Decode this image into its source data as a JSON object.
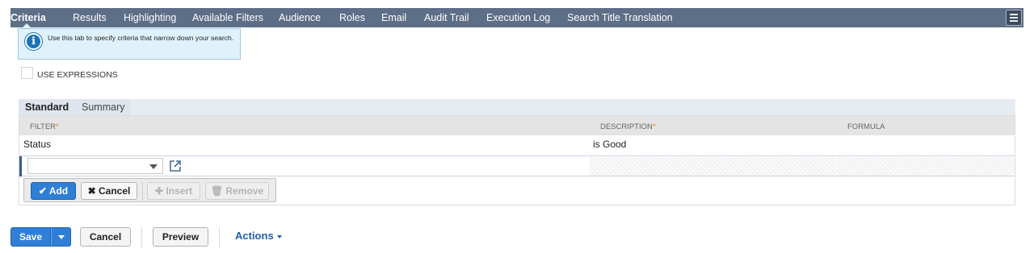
{
  "tabs": [
    {
      "label": "Criteria",
      "active": true
    },
    {
      "label": "Results"
    },
    {
      "label": "Highlighting"
    },
    {
      "label": "Available Filters"
    },
    {
      "label": "Audience"
    },
    {
      "label": "Roles"
    },
    {
      "label": "Email"
    },
    {
      "label": "Audit Trail"
    },
    {
      "label": "Execution Log"
    },
    {
      "label": "Search Title Translation"
    }
  ],
  "tooltip": {
    "text": "Use this tab to specify criteria that narrow down your search."
  },
  "use_expressions": {
    "label": "USE EXPRESSIONS",
    "checked": false
  },
  "subtabs": [
    {
      "label": "Standard",
      "active": true
    },
    {
      "label": "Summary"
    }
  ],
  "grid": {
    "headers": [
      {
        "label": "FILTER",
        "required": "*"
      },
      {
        "label": "DESCRIPTION",
        "required": "*"
      },
      {
        "label": "FORMULA",
        "required": ""
      }
    ],
    "rows": [
      {
        "filter": "Status",
        "description": "is Good",
        "formula": ""
      }
    ],
    "buttons": {
      "add": "Add",
      "cancel": "Cancel",
      "insert": "Insert",
      "remove": "Remove"
    }
  },
  "footer": {
    "save": "Save",
    "cancel": "Cancel",
    "preview": "Preview",
    "actions": "Actions"
  },
  "colors": {
    "tab_bar": "#5d6e87",
    "primary": "#2f7fd6",
    "info": "#dff2fb"
  }
}
